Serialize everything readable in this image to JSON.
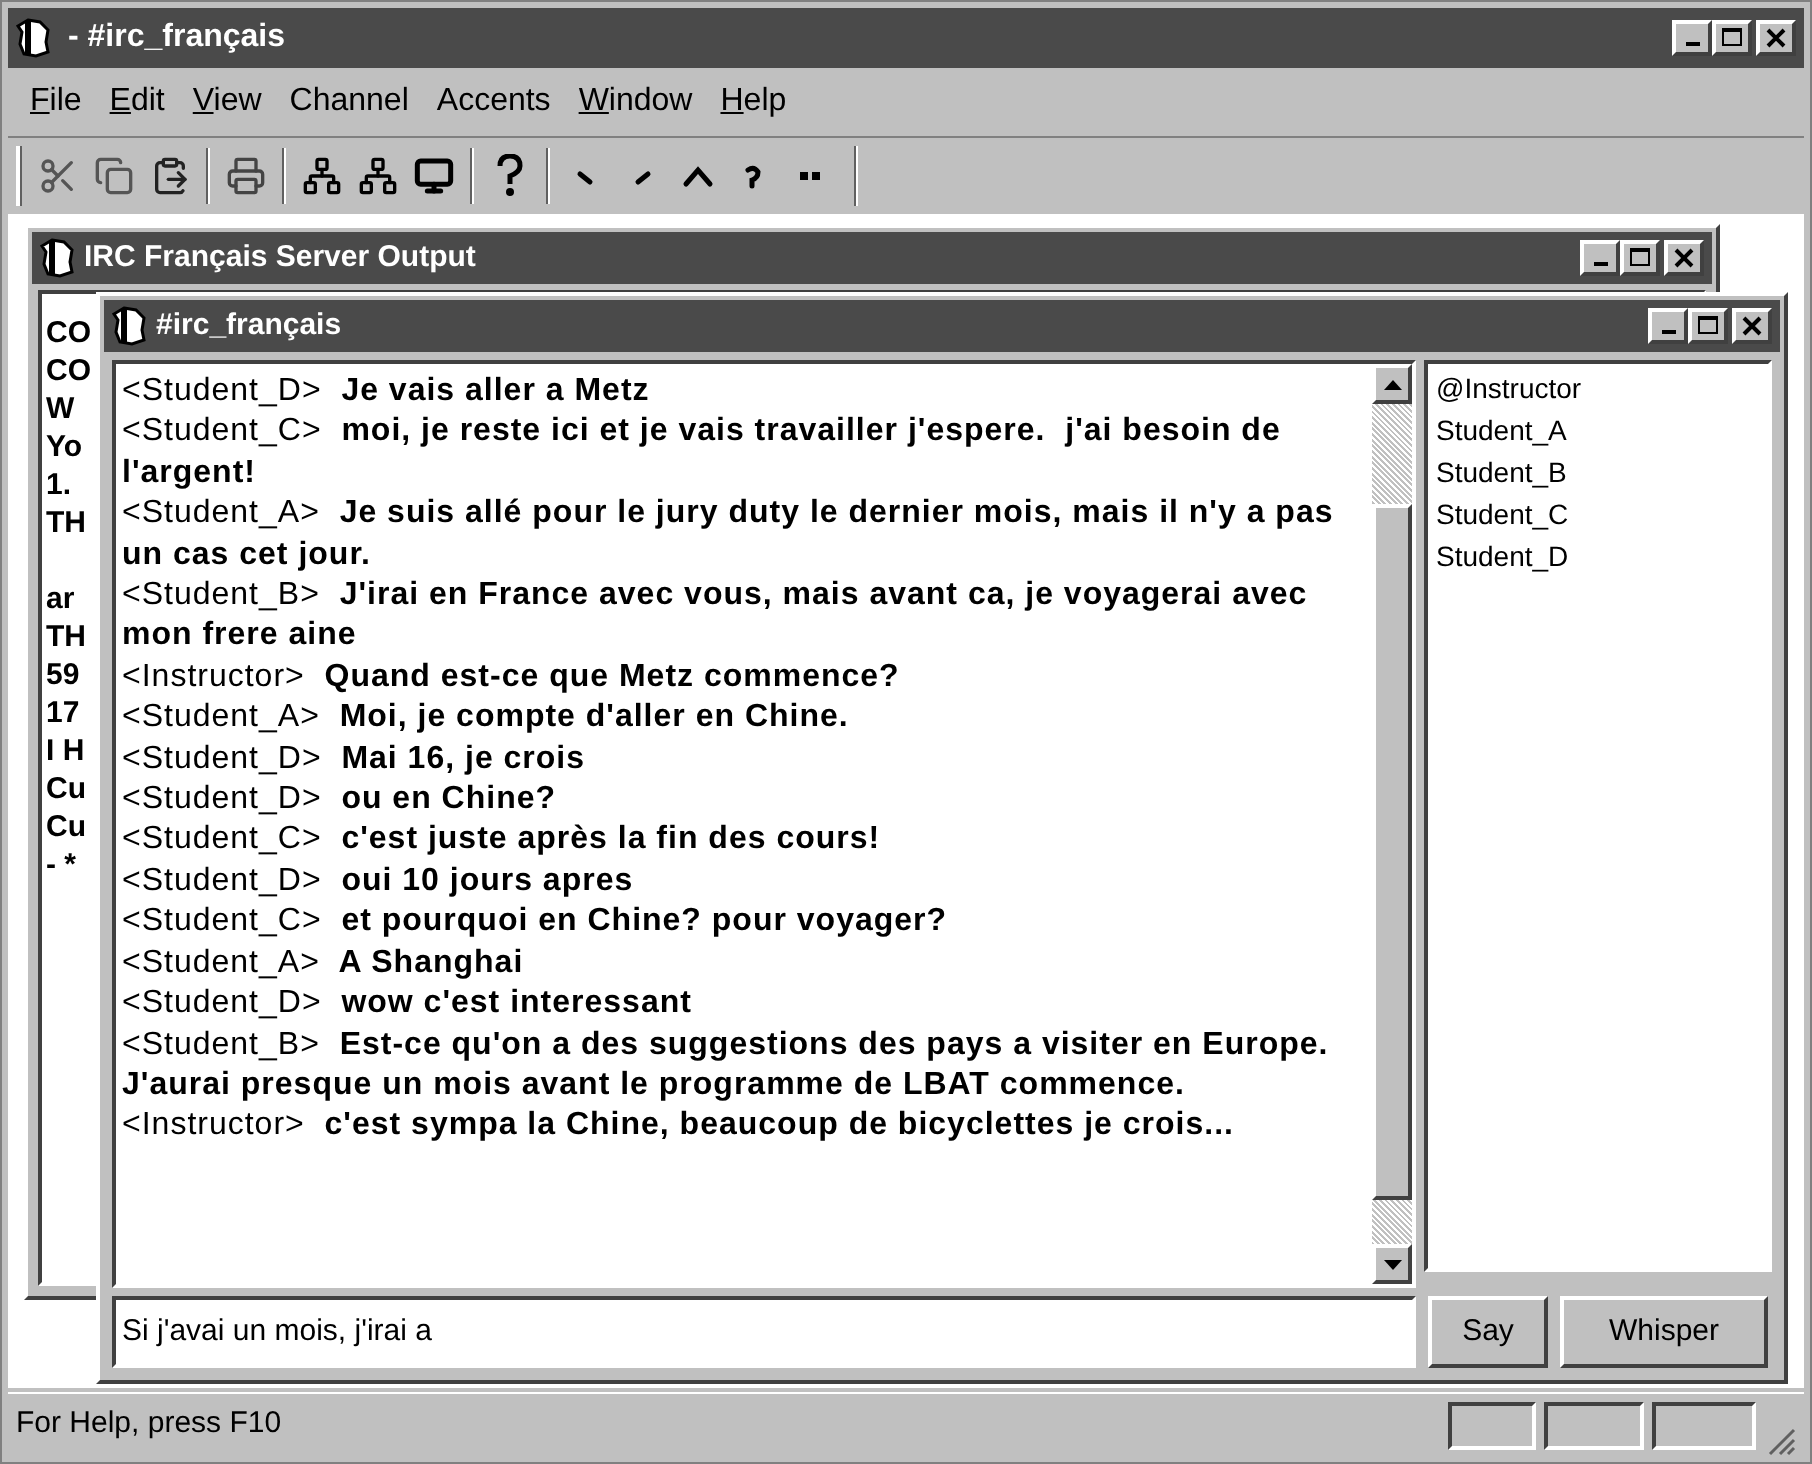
{
  "window": {
    "title": "- #irc_français"
  },
  "menu": [
    {
      "label": "File",
      "access_key": true
    },
    {
      "label": "Edit",
      "access_key": true
    },
    {
      "label": "View",
      "access_key": true
    },
    {
      "label": "Channel",
      "access_key": false
    },
    {
      "label": "Accents",
      "access_key": false
    },
    {
      "label": "Window",
      "access_key": true
    },
    {
      "label": "Help",
      "access_key": true
    }
  ],
  "server_window": {
    "title": "IRC Français Server Output",
    "lines": [
      {
        "text": "CO",
        "gap_before": false
      },
      {
        "text": "CO",
        "gap_before": false
      },
      {
        "text": "W",
        "gap_before": false
      },
      {
        "text": "Yo",
        "gap_before": false
      },
      {
        "text": "1.",
        "gap_before": false
      },
      {
        "text": "TH",
        "gap_before": false
      },
      {
        "text": "ar",
        "gap_before": true
      },
      {
        "text": "TH",
        "gap_before": false
      },
      {
        "text": "59",
        "gap_before": false
      },
      {
        "text": "17",
        "gap_before": false
      },
      {
        "text": "I H",
        "gap_before": false
      },
      {
        "text": "Cu",
        "gap_before": false
      },
      {
        "text": "Cu",
        "gap_before": false
      },
      {
        "text": "- *",
        "gap_before": false
      }
    ]
  },
  "chat_window": {
    "title": "#irc_français",
    "messages": [
      {
        "nick": "<Student_D>",
        "text": "Je vais aller a Metz"
      },
      {
        "nick": "<Student_C>",
        "text": "moi, je reste ici et je vais travailler j'espere.  j'ai besoin de l'argent!"
      },
      {
        "nick": "<Student_A>",
        "text": "Je suis allé pour le jury duty le dernier mois, mais il n'y a pas un cas cet jour."
      },
      {
        "nick": "<Student_B>",
        "text": "J'irai en France avec vous, mais avant ca, je voyagerai avec mon frere aine"
      },
      {
        "nick": "<Instructor>",
        "text": "Quand est-ce que Metz commence?"
      },
      {
        "nick": "<Student_A>",
        "text": "Moi, je compte d'aller en Chine."
      },
      {
        "nick": "<Student_D>",
        "text": "Mai 16, je crois"
      },
      {
        "nick": "<Student_D>",
        "text": "ou en Chine?"
      },
      {
        "nick": "<Student_C>",
        "text": "c'est juste après la fin des cours!"
      },
      {
        "nick": "<Student_D>",
        "text": "oui 10 jours apres"
      },
      {
        "nick": "<Student_C>",
        "text": "et pourquoi en Chine? pour voyager?"
      },
      {
        "nick": "<Student_A>",
        "text": "A Shanghai"
      },
      {
        "nick": "<Student_D>",
        "text": "wow c'est interessant"
      },
      {
        "nick": "<Student_B>",
        "text": "Est-ce qu'on a des suggestions des pays a visiter en Europe.  J'aurai presque un mois avant le programme de LBAT commence."
      },
      {
        "nick": "<Instructor>",
        "text": "c'est sympa la Chine, beaucoup de bicyclettes je crois..."
      }
    ],
    "users": [
      "@Instructor",
      "Student_A",
      "Student_B",
      "Student_C",
      "Student_D"
    ],
    "input": {
      "value": "Si j'avai un mois, j'irai a"
    },
    "buttons": [
      "Say",
      "Whisper"
    ]
  },
  "status_bar": {
    "text": "For Help, press F10"
  }
}
